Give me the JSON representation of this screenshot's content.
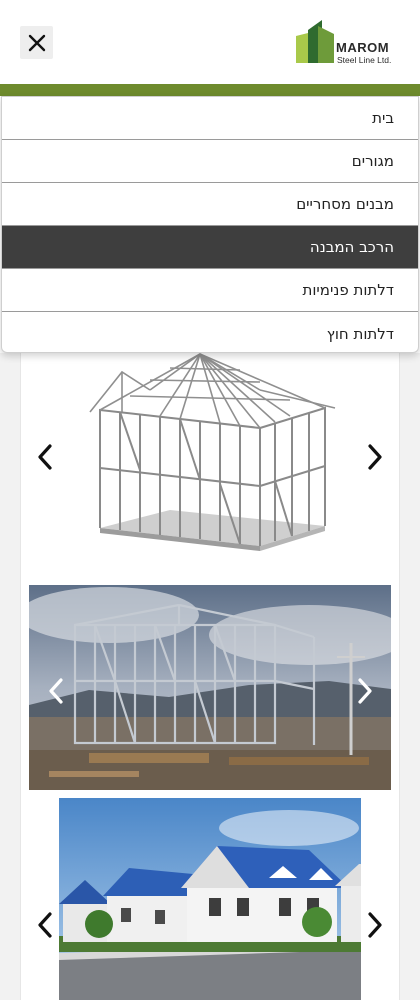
{
  "header": {
    "close_icon": "close-icon",
    "logo": {
      "title": "MAROM",
      "subtitle": "Steel Line Ltd."
    }
  },
  "colors": {
    "brand_green": "#6e8b2d",
    "active_menu_bg": "#3e3e3e"
  },
  "menu": {
    "items": [
      {
        "label": "בית"
      },
      {
        "label": "מגורים"
      },
      {
        "label": "מבנים מסחריים"
      },
      {
        "label": "הרכב המבנה",
        "active": true
      },
      {
        "label": "דלתות פנימיות"
      },
      {
        "label": "דלתות חוץ"
      }
    ]
  },
  "carousels": [
    {
      "image": "steel-frame-house-model",
      "prev_icon": "chevron-left-icon",
      "next_icon": "chevron-right-icon"
    },
    {
      "image": "steel-frame-construction-site",
      "prev_icon": "chevron-left-icon",
      "next_icon": "chevron-right-icon"
    },
    {
      "image": "finished-houses-blue-roofs",
      "prev_icon": "chevron-left-icon",
      "next_icon": "chevron-right-icon"
    }
  ]
}
